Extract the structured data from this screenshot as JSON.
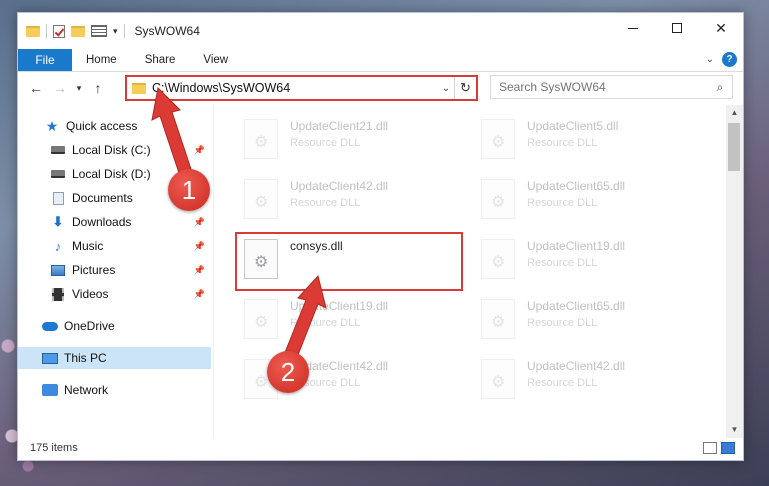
{
  "window": {
    "title": "SysWOW64",
    "minimize_label": "",
    "close_glyph": "✕"
  },
  "ribbon": {
    "tabs": [
      "File",
      "Home",
      "Share",
      "View"
    ],
    "help_glyph": "?"
  },
  "address": {
    "path": "C:\\Windows\\SysWOW64",
    "search_placeholder": "Search SysWOW64"
  },
  "nav": {
    "items": [
      {
        "label": "Quick access",
        "icon": "star-icon",
        "pinned": false
      },
      {
        "label": "Local Disk (C:)",
        "icon": "drive-icon",
        "pinned": true
      },
      {
        "label": "Local Disk (D:)",
        "icon": "drive-icon",
        "pinned": false
      },
      {
        "label": "Documents",
        "icon": "documents-icon",
        "pinned": true
      },
      {
        "label": "Downloads",
        "icon": "downloads-icon",
        "pinned": true
      },
      {
        "label": "Music",
        "icon": "music-icon",
        "pinned": true
      },
      {
        "label": "Pictures",
        "icon": "pictures-icon",
        "pinned": true
      },
      {
        "label": "Videos",
        "icon": "videos-icon",
        "pinned": true
      },
      {
        "label": "OneDrive",
        "icon": "onedrive-icon",
        "pinned": false
      },
      {
        "label": "This PC",
        "icon": "this-pc-icon",
        "pinned": false,
        "selected": true
      },
      {
        "label": "Network",
        "icon": "network-icon",
        "pinned": false
      }
    ]
  },
  "files": [
    {
      "name": "UpdateClient21.dll",
      "type": "Resource DLL"
    },
    {
      "name": "UpdateClient5.dll",
      "type": "Resource DLL"
    },
    {
      "name": "UpdateClient42.dll",
      "type": "Resource DLL"
    },
    {
      "name": "UpdateClient65.dll",
      "type": "Resource DLL"
    },
    {
      "name": "consys.dll",
      "type": ""
    },
    {
      "name": "UpdateClient19.dll",
      "type": "Resource DLL"
    },
    {
      "name": "UpdateClient19.dll",
      "type": "Resource DLL"
    },
    {
      "name": "UpdateClient65.dll",
      "type": "Resource DLL"
    },
    {
      "name": "UpdateClient42.dll",
      "type": "Resource DLL"
    },
    {
      "name": "UpdateClient42.dll",
      "type": "Resource DLL"
    }
  ],
  "status": {
    "item_count": "175 items"
  },
  "annotations": {
    "badge1": "1",
    "badge2": "2",
    "accent_color": "#d93a3a"
  }
}
